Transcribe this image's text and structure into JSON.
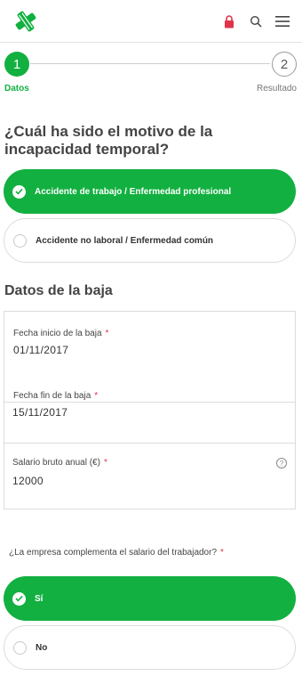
{
  "header": {
    "logo_icon": "green-cross-logo",
    "icons": [
      "lock-icon",
      "search-icon",
      "menu-icon"
    ],
    "colors": {
      "logo": "#12b040",
      "lock": "#e0344a"
    }
  },
  "stepper": {
    "steps": [
      {
        "number": "1",
        "label": "Datos",
        "active": true
      },
      {
        "number": "2",
        "label": "Resultado",
        "active": false
      }
    ]
  },
  "question1": {
    "text": "¿Cuál ha sido el motivo de la incapacidad temporal?",
    "options": [
      {
        "label": "Accidente de trabajo / Enfermedad profesional",
        "selected": true
      },
      {
        "label": "Accidente no laboral / Enfermedad común",
        "selected": false
      }
    ]
  },
  "section": {
    "title": "Datos de la baja"
  },
  "form": {
    "fields": [
      {
        "label": "Fecha inicio de la baja",
        "required_mark": "*",
        "value": "01/11/2017"
      },
      {
        "label": "Fecha fin de la baja",
        "required_mark": "*",
        "value": "15/11/2017"
      },
      {
        "label": "Salario bruto anual (€)",
        "required_mark": "*",
        "value": "12000",
        "help_icon": "?"
      }
    ]
  },
  "question2": {
    "text": "¿La empresa complementa el salario del trabajador?",
    "required_mark": "*",
    "options": [
      {
        "label": "Sí",
        "selected": true
      },
      {
        "label": "No",
        "selected": false
      }
    ]
  },
  "colors": {
    "accent": "#12b040",
    "required": "#e0344a"
  }
}
